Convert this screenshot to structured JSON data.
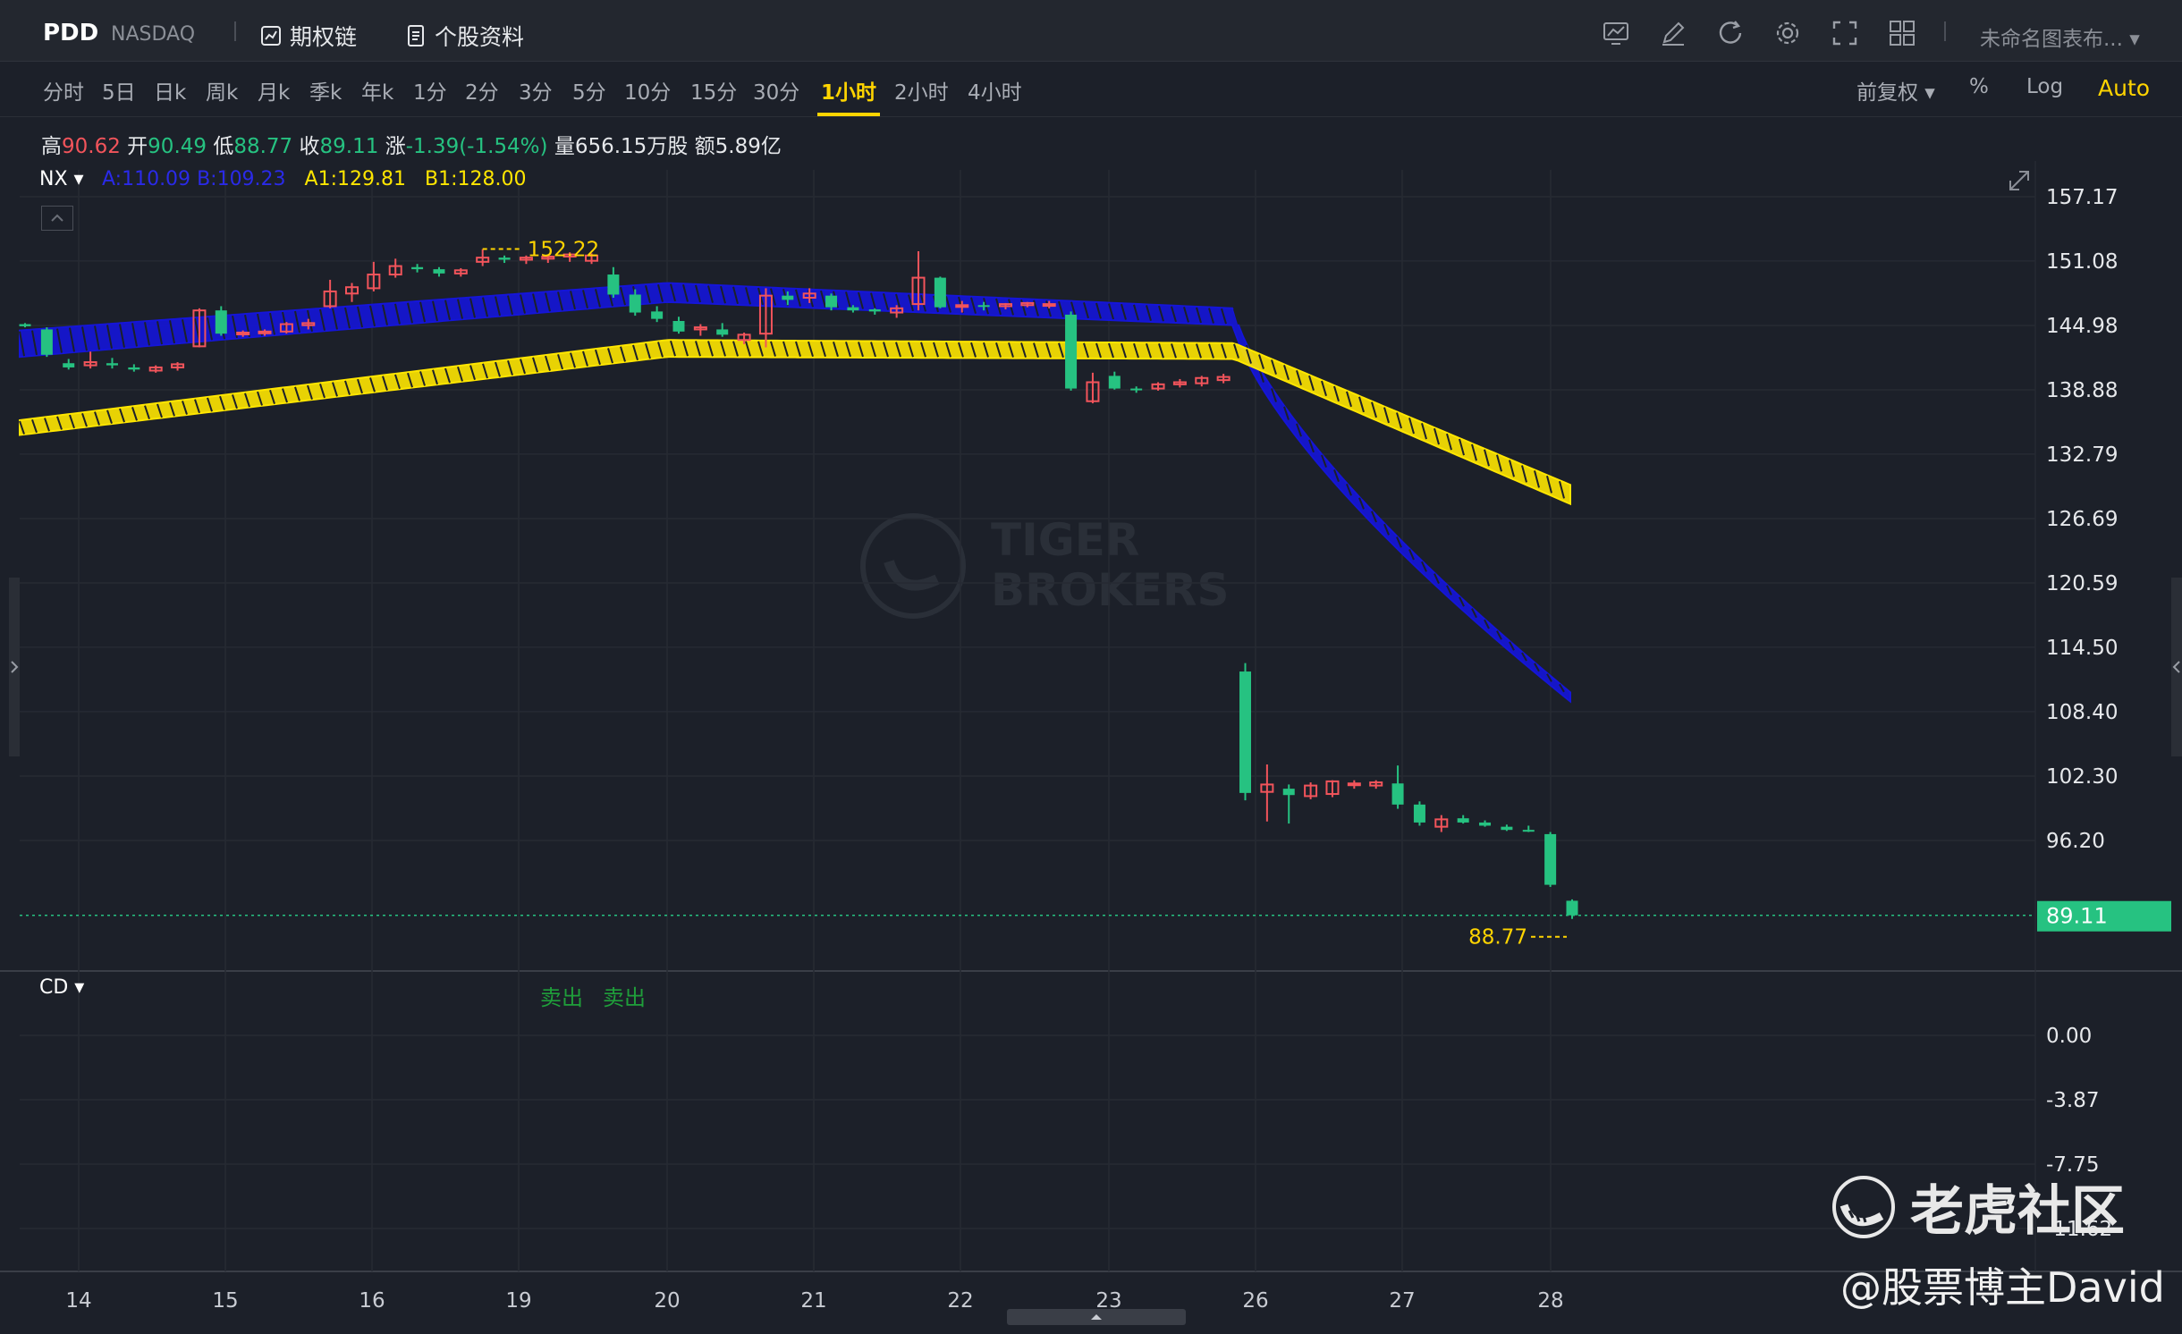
{
  "header": {
    "ticker": "PDD",
    "exchange": "NASDAQ",
    "links": [
      {
        "label": "期权链",
        "icon": "option-chain-icon"
      },
      {
        "label": "个股资料",
        "icon": "document-icon"
      }
    ],
    "tools": [
      "chart-template-icon",
      "pencil-icon",
      "refresh-icon",
      "settings-icon",
      "fullscreen-icon",
      "layout-grid-icon"
    ],
    "layout_name": "未命名图表布..."
  },
  "intervals": [
    "分时",
    "5日",
    "日k",
    "周k",
    "月k",
    "季k",
    "年k",
    "1分",
    "2分",
    "3分",
    "5分",
    "10分",
    "15分",
    "30分",
    "1小时",
    "2小时",
    "4小时"
  ],
  "active_interval": "1小时",
  "right_options": {
    "adjust": "前复权",
    "percent": "%",
    "log": "Log",
    "auto": "Auto"
  },
  "stats": {
    "high_label": "高",
    "high": "90.62",
    "open_label": "开",
    "open": "90.49",
    "low_label": "低",
    "low": "88.77",
    "close_label": "收",
    "close": "89.11",
    "change_label": "涨",
    "change": "-1.39(-1.54%)",
    "volume_label": "量",
    "volume": "656.15万股",
    "amount_label": "额",
    "amount": "5.89亿"
  },
  "indicators": {
    "main": "NX",
    "legend": {
      "a": "A:110.09",
      "b": "B:109.23",
      "a1": "A1:129.81",
      "b1": "B1:128.00"
    },
    "sub": "CD",
    "signals": [
      "卖出",
      "卖出"
    ]
  },
  "colors": {
    "up": "#f2545b",
    "down": "#26c281",
    "band_blue": "#1515d8",
    "band_yellow": "#ffe600",
    "accent": "#ffd400"
  },
  "watermark": {
    "brand_line1": "TIGER",
    "brand_line2": "BROKERS"
  },
  "brand": {
    "name": "老虎社区",
    "author": "@股票博主David"
  },
  "chart_data": {
    "type": "candlestick",
    "interval": "1小时",
    "x_labels": [
      "14",
      "15",
      "16",
      "19",
      "20",
      "21",
      "22",
      "23",
      "26",
      "27",
      "28"
    ],
    "y_ticks": [
      "157.17",
      "151.08",
      "144.98",
      "138.88",
      "132.79",
      "126.69",
      "120.59",
      "114.50",
      "108.40",
      "102.30",
      "96.20"
    ],
    "ylim": [
      86.0,
      160.5
    ],
    "last_price": "89.11",
    "annotations": {
      "high": "152.22",
      "low": "88.77"
    },
    "candles": [
      [
        145.1,
        145.2,
        144.8,
        144.9
      ],
      [
        144.6,
        144.8,
        142.0,
        142.2
      ],
      [
        141.4,
        141.8,
        140.8,
        141.0
      ],
      [
        141.2,
        142.5,
        140.9,
        141.5
      ],
      [
        141.4,
        141.9,
        140.9,
        141.2
      ],
      [
        141.0,
        141.3,
        140.6,
        140.8
      ],
      [
        140.7,
        141.2,
        140.5,
        141.0
      ],
      [
        141.0,
        141.5,
        140.7,
        141.3
      ],
      [
        143.0,
        146.6,
        142.9,
        146.4
      ],
      [
        146.4,
        146.8,
        144.0,
        144.2
      ],
      [
        144.2,
        144.5,
        143.9,
        144.3
      ],
      [
        144.3,
        144.6,
        144.0,
        144.4
      ],
      [
        144.4,
        145.3,
        144.2,
        145.1
      ],
      [
        145.0,
        145.6,
        144.6,
        145.2
      ],
      [
        146.8,
        149.3,
        146.6,
        148.2
      ],
      [
        148.0,
        149.0,
        147.2,
        148.6
      ],
      [
        148.5,
        151.0,
        148.2,
        149.8
      ],
      [
        149.8,
        151.3,
        149.5,
        150.6
      ],
      [
        150.5,
        150.8,
        150.0,
        150.3
      ],
      [
        150.3,
        150.5,
        149.6,
        149.9
      ],
      [
        149.9,
        150.4,
        149.6,
        150.2
      ],
      [
        151.0,
        152.2,
        150.6,
        151.4
      ],
      [
        151.4,
        151.6,
        150.9,
        151.2
      ],
      [
        151.2,
        151.6,
        150.8,
        151.4
      ],
      [
        151.3,
        151.7,
        150.9,
        151.5
      ],
      [
        151.5,
        151.9,
        151.0,
        151.7
      ],
      [
        151.1,
        151.8,
        150.8,
        151.6
      ],
      [
        149.8,
        150.5,
        147.6,
        147.9
      ],
      [
        147.9,
        148.4,
        145.9,
        146.2
      ],
      [
        146.3,
        146.8,
        145.3,
        145.6
      ],
      [
        145.4,
        145.8,
        144.2,
        144.4
      ],
      [
        144.6,
        145.1,
        144.0,
        144.8
      ],
      [
        144.6,
        145.2,
        143.9,
        144.1
      ],
      [
        143.6,
        144.3,
        143.2,
        144.1
      ],
      [
        144.2,
        148.5,
        142.9,
        147.8
      ],
      [
        147.8,
        148.2,
        146.9,
        147.4
      ],
      [
        147.6,
        148.5,
        147.1,
        148.0
      ],
      [
        147.8,
        148.0,
        146.4,
        146.7
      ],
      [
        146.7,
        146.9,
        146.2,
        146.4
      ],
      [
        146.5,
        146.6,
        146.0,
        146.3
      ],
      [
        146.2,
        146.9,
        145.7,
        146.6
      ],
      [
        147.0,
        152.0,
        146.4,
        149.5
      ],
      [
        149.5,
        149.6,
        146.6,
        146.7
      ],
      [
        146.8,
        147.3,
        146.2,
        146.9
      ],
      [
        146.9,
        147.2,
        146.4,
        146.8
      ],
      [
        146.8,
        147.1,
        146.5,
        147.0
      ],
      [
        146.9,
        147.2,
        146.7,
        147.1
      ],
      [
        146.9,
        147.3,
        146.6,
        147.0
      ],
      [
        146.0,
        146.3,
        138.8,
        139.0
      ],
      [
        137.8,
        140.5,
        137.6,
        139.6
      ],
      [
        140.2,
        140.6,
        138.9,
        139.0
      ],
      [
        139.0,
        139.2,
        138.6,
        138.9
      ],
      [
        139.0,
        139.6,
        138.8,
        139.4
      ],
      [
        139.4,
        139.9,
        139.1,
        139.6
      ],
      [
        139.5,
        140.2,
        139.2,
        140.0
      ],
      [
        139.8,
        140.4,
        139.5,
        140.1
      ],
      [
        112.2,
        113.0,
        100.0,
        100.7
      ],
      [
        100.8,
        103.4,
        98.0,
        101.5
      ],
      [
        101.1,
        101.5,
        97.8,
        100.5
      ],
      [
        100.4,
        101.7,
        100.1,
        101.4
      ],
      [
        100.6,
        101.9,
        100.3,
        101.8
      ],
      [
        101.5,
        101.9,
        101.1,
        101.6
      ],
      [
        101.4,
        101.9,
        101.1,
        101.7
      ],
      [
        101.6,
        103.3,
        99.2,
        99.6
      ],
      [
        99.6,
        99.9,
        97.6,
        97.9
      ],
      [
        97.5,
        98.6,
        97.0,
        98.2
      ],
      [
        98.3,
        98.6,
        97.8,
        97.9
      ],
      [
        97.9,
        98.1,
        97.5,
        97.6
      ],
      [
        97.5,
        97.7,
        97.1,
        97.2
      ],
      [
        97.2,
        97.6,
        97.0,
        97.1
      ],
      [
        96.8,
        97.0,
        91.8,
        92.0
      ],
      [
        90.49,
        90.62,
        88.77,
        89.11
      ]
    ],
    "indicator_bands": [
      {
        "name": "A",
        "color": "blue",
        "start": [
          144.5,
          142.0
        ],
        "peak": [
          149.0,
          147.2
        ],
        "flat_end": [
          146.6,
          145.0
        ],
        "end": [
          110.09,
          109.23
        ]
      },
      {
        "name": "A1",
        "color": "yellow",
        "start": [
          136.0,
          134.6
        ],
        "peak": [
          143.6,
          142.0
        ],
        "flat_end": [
          143.3,
          141.8
        ],
        "end": [
          129.81,
          128.0
        ]
      }
    ],
    "sub_panel": {
      "label": "CD",
      "y_ticks": [
        "0.00",
        "-3.87",
        "-7.75",
        "-11.62"
      ]
    }
  }
}
